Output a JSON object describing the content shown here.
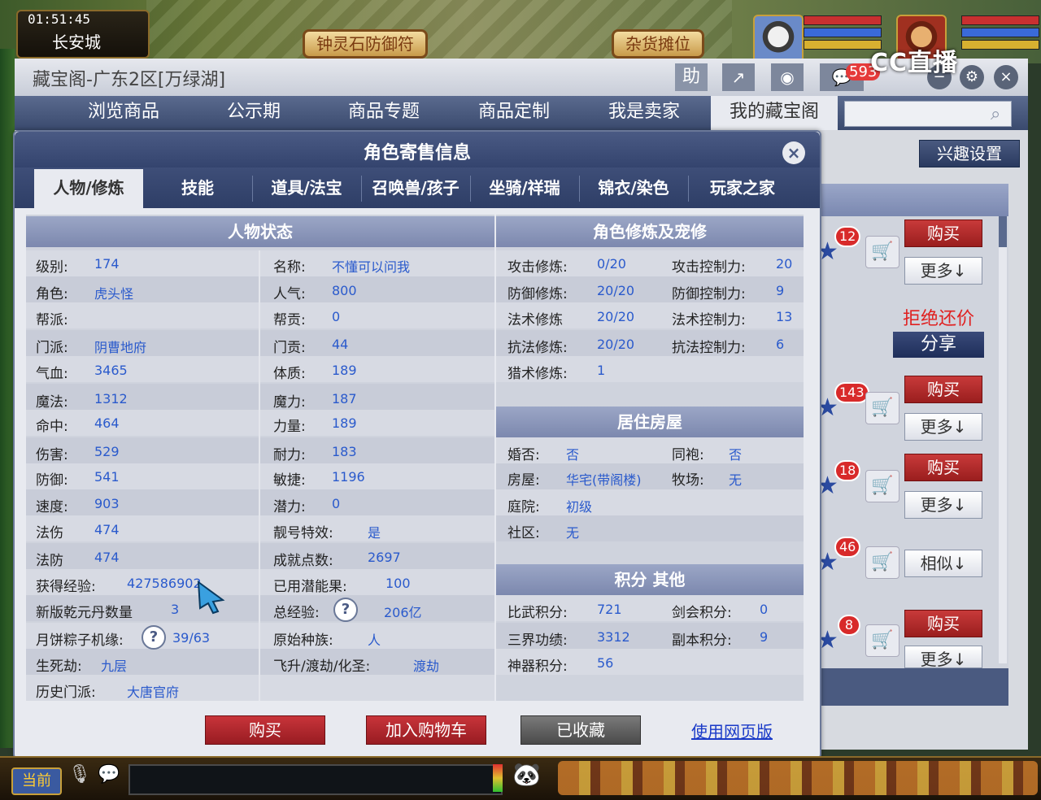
{
  "game": {
    "clock": "01:51:45",
    "city": "长安城",
    "scroll_left": "钟灵石防御符",
    "scroll_right": "杂货摊位",
    "current_channel": "当前"
  },
  "overlay": {
    "logo_text": "CC直播"
  },
  "window": {
    "title": "藏宝阁-广东2区[万绿湖]",
    "help_label": "助",
    "message_count": "593"
  },
  "nav": {
    "items": [
      {
        "label": "浏览商品"
      },
      {
        "label": "公示期"
      },
      {
        "label": "商品专题"
      },
      {
        "label": "商品定制"
      },
      {
        "label": "我是卖家"
      },
      {
        "label": "我的藏宝阁"
      }
    ],
    "search_placeholder": ""
  },
  "right_panel": {
    "interest_label": "兴趣设置",
    "buy_label": "购买",
    "more_label": "更多↓",
    "similar_label": "相似↓",
    "refuse_label": "拒绝还价",
    "share_label": "分享",
    "counts": [
      "12",
      "143",
      "18",
      "46",
      "8"
    ]
  },
  "modal": {
    "title": "角色寄售信息",
    "tabs": [
      "人物/修炼",
      "技能",
      "道具/法宝",
      "召唤兽/孩子",
      "坐骑/祥瑞",
      "锦衣/染色",
      "玩家之家"
    ],
    "status_header": "人物状态",
    "cultivation_header": "角色修炼及宠修",
    "house_header": "居住房屋",
    "score_header": "积分 其他",
    "status_left": [
      {
        "label": "级别:",
        "value": "174"
      },
      {
        "label": "角色:",
        "value": "虎头怪"
      },
      {
        "label": "帮派:",
        "value": ""
      },
      {
        "label": "门派:",
        "value": "阴曹地府"
      },
      {
        "label": "气血:",
        "value": "3465"
      },
      {
        "label": "魔法:",
        "value": "1312"
      },
      {
        "label": "命中:",
        "value": "464"
      },
      {
        "label": "伤害:",
        "value": "529"
      },
      {
        "label": "防御:",
        "value": "541"
      },
      {
        "label": "速度:",
        "value": "903"
      },
      {
        "label": "法伤",
        "value": "474"
      },
      {
        "label": "法防",
        "value": "474"
      },
      {
        "label": "获得经验:",
        "value": "427586902"
      },
      {
        "label": "新版乾元丹数量",
        "value": "3"
      },
      {
        "label": "月饼粽子机缘:",
        "value": "39/63"
      },
      {
        "label": "生死劫:",
        "value": "九层"
      },
      {
        "label": "历史门派:",
        "value": "大唐官府"
      }
    ],
    "status_right": [
      {
        "label": "名称:",
        "value": "不懂可以问我"
      },
      {
        "label": "人气:",
        "value": "800"
      },
      {
        "label": "帮贡:",
        "value": "0"
      },
      {
        "label": "门贡:",
        "value": "44"
      },
      {
        "label": "体质:",
        "value": "189"
      },
      {
        "label": "魔力:",
        "value": "187"
      },
      {
        "label": "力量:",
        "value": "189"
      },
      {
        "label": "耐力:",
        "value": "183"
      },
      {
        "label": "敏捷:",
        "value": "1196"
      },
      {
        "label": "潜力:",
        "value": "0"
      },
      {
        "label": "靓号特效:",
        "value": "是"
      },
      {
        "label": "成就点数:",
        "value": "2697"
      },
      {
        "label": "已用潜能果:",
        "value": "100"
      },
      {
        "label": "总经验:",
        "value": "206亿"
      },
      {
        "label": "原始种族:",
        "value": "人"
      },
      {
        "label": "飞升/渡劫/化圣:",
        "value": "渡劫"
      }
    ],
    "cultivation": [
      {
        "label": "攻击修炼:",
        "value": "0/20",
        "label2": "攻击控制力:",
        "value2": "20"
      },
      {
        "label": "防御修炼:",
        "value": "20/20",
        "label2": "防御控制力:",
        "value2": "9"
      },
      {
        "label": "法术修炼",
        "value": "20/20",
        "label2": "法术控制力:",
        "value2": "13"
      },
      {
        "label": "抗法修炼:",
        "value": "20/20",
        "label2": "抗法控制力:",
        "value2": "6"
      },
      {
        "label": "猎术修炼:",
        "value": "1",
        "label2": "",
        "value2": ""
      }
    ],
    "house": [
      {
        "label": "婚否:",
        "value": "否",
        "label2": "同袍:",
        "value2": "否"
      },
      {
        "label": "房屋:",
        "value": "华宅(带阁楼)",
        "label2": "牧场:",
        "value2": "无"
      },
      {
        "label": "庭院:",
        "value": "初级",
        "label2": "",
        "value2": ""
      },
      {
        "label": "社区:",
        "value": "无",
        "label2": "",
        "value2": ""
      }
    ],
    "scores": [
      {
        "label": "比武积分:",
        "value": "721",
        "label2": "剑会积分:",
        "value2": "0"
      },
      {
        "label": "三界功绩:",
        "value": "3312",
        "label2": "副本积分:",
        "value2": "9"
      },
      {
        "label": "神器积分:",
        "value": "56",
        "label2": "",
        "value2": ""
      }
    ],
    "question_mark": "?",
    "buttons": {
      "buy": "购买",
      "add_cart": "加入购物车",
      "collected": "已收藏",
      "web_version": "使用网页版"
    }
  }
}
